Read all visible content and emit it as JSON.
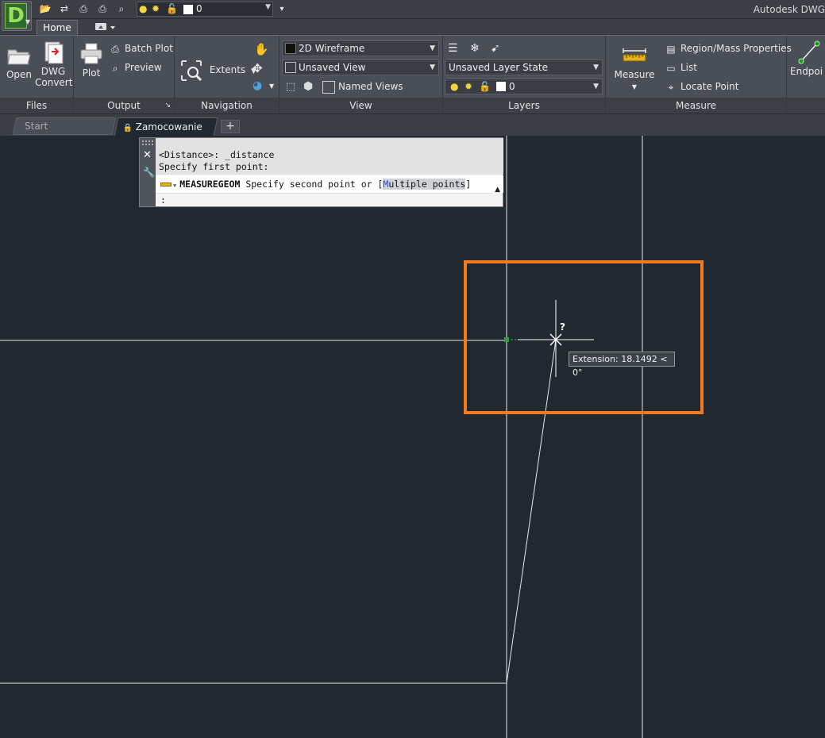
{
  "app": {
    "logo_letter": "D",
    "title": "Autodesk DWG"
  },
  "quick_access": {
    "layer_value": "0"
  },
  "ribbon_tabs": {
    "home": "Home"
  },
  "ribbon": {
    "files": {
      "label": "Files",
      "open": "Open",
      "dwg_convert_line1": "DWG",
      "dwg_convert_line2": "Convert"
    },
    "output": {
      "label": "Output",
      "plot": "Plot",
      "batch_plot": "Batch Plot",
      "preview": "Preview"
    },
    "navigation": {
      "label": "Navigation",
      "extents": "Extents"
    },
    "view": {
      "label": "View",
      "visual_style": "2D Wireframe",
      "saved_view": "Unsaved View",
      "named_views": "Named Views"
    },
    "layers": {
      "label": "Layers",
      "layer_state": "Unsaved Layer State",
      "current_layer": "0"
    },
    "measure": {
      "label": "Measure",
      "measure_btn": "Measure",
      "region_mass": "Region/Mass Properties",
      "list": "List",
      "locate_point": "Locate Point"
    },
    "snap": {
      "endpoint": "Endpoi"
    }
  },
  "doc_tabs": {
    "start": "Start",
    "active": "Zamocowanie",
    "close": "✕",
    "add": "+"
  },
  "command_line": {
    "history_line1": "<Distance>: _distance",
    "history_line2": "Specify first point:",
    "command_name": "MEASUREGEOM",
    "prompt_text": "Specify second point or [",
    "option_key": "M",
    "option_rest": "ultiple points",
    "prompt_end": "]",
    "input": ":"
  },
  "tooltip": {
    "text": "Extension: 18.1492 < 0°",
    "cursor_mark": "?"
  },
  "colors": {
    "highlight": "#f47a20",
    "canvas": "#212830",
    "ribbon": "#4a4f57"
  }
}
